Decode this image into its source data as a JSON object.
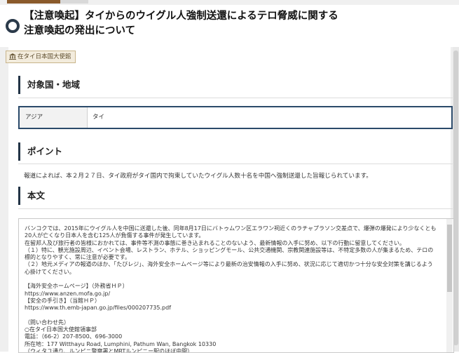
{
  "page": {
    "title": "【注意喚起】タイからのウイグル人強制送還によるテロ脅威に関する注意喚起の発出について"
  },
  "embassy_tag": "在タイ日本国大使館",
  "sections": {
    "region_heading": "対象国・地域",
    "point_heading": "ポイント",
    "body_heading": "本文"
  },
  "region": {
    "area": "アジア",
    "country": "タイ"
  },
  "point_text": "報道によれば、本２月２７日、タイ政府がタイ国内で拘束していたウイグル人数十名を中国へ強制送還した旨報じられています。",
  "body_text": "バンコクでは、2015年にウイグル人を中国に送還した後、同年8月17日にバトゥムワン区エラワン祠近くのラチャプラソン交差点で、爆弾の爆発により少なくとも20人が亡くなり日本人を含む125人が負傷する事件が発生しています。\n在留邦人及び旅行者の皆様におかれては、事件等不測の事態に巻き込まれることのないよう、最新情報の入手に努め、以下の行動に留意してください。\n（１）特に、観光施設周辺、イベント会場、レストラン、ホテル、ショッピングモール、公共交通機関、宗教関連施設等は、不特定多数の人が集まるため、テロの標的となりやすく、常に注意が必要です。\n（２）地元メディアの報道のほか、「たびレジ」、海外安全ホームページ等により最新の治安情報の入手に努め、状況に応じて適切かつ十分な安全対策を講じるよう心掛けてください。\n\n【海外安全ホームページ】（外務省ＨＰ）\nhttps://www.anzen.mofa.go.jp/\n【安全の手引き】（当館ＨＰ）\nhttps://www.th.emb-japan.go.jp/files/000207735.pdf\n\n（問い合わせ先）\n○在タイ日本国大使館領事部\n電話：（66-2）207-8500、696-3000\n所在地：177 Witthayu Road, Lumphini, Pathum Wan, Bangkok 10330\n（ウィタユ通り、ルンピニ警察署とMRTルンピニー駅のほぼ中間）\n\n○在留届を提出されている方は、記載事項変更（転居等による住所変更・携帯電話番号やemailアドレスの追加・変更等）、または帰国・転出等があれば、"
}
